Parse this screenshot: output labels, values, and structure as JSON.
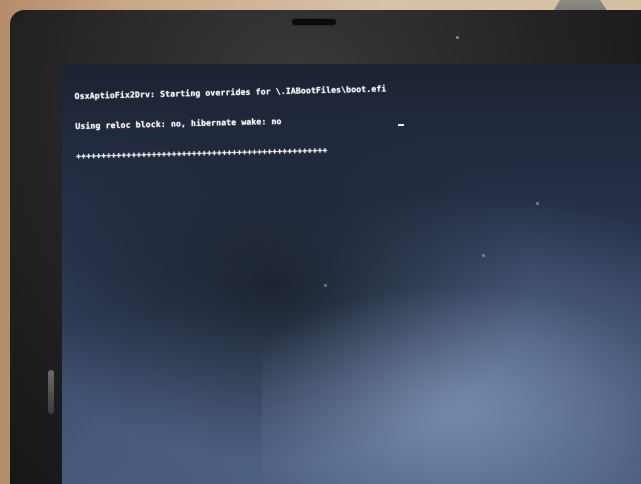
{
  "photo": {
    "subject": "laptop-screen"
  },
  "terminal": {
    "line1": "OsxAptioFix2Drv: Starting overrides for \\.IABootFiles\\boot.efi",
    "line2": "Using reloc block: no, hibernate wake: no",
    "line3": "++++++++++++++++++++++++++++++++++++++++++++++++++"
  },
  "colors": {
    "bezel": "#222224",
    "screen_top": "#1b2232",
    "screen_bottom": "#46597c",
    "text": "#f2f2f2",
    "wall": "#d8c3a6"
  }
}
